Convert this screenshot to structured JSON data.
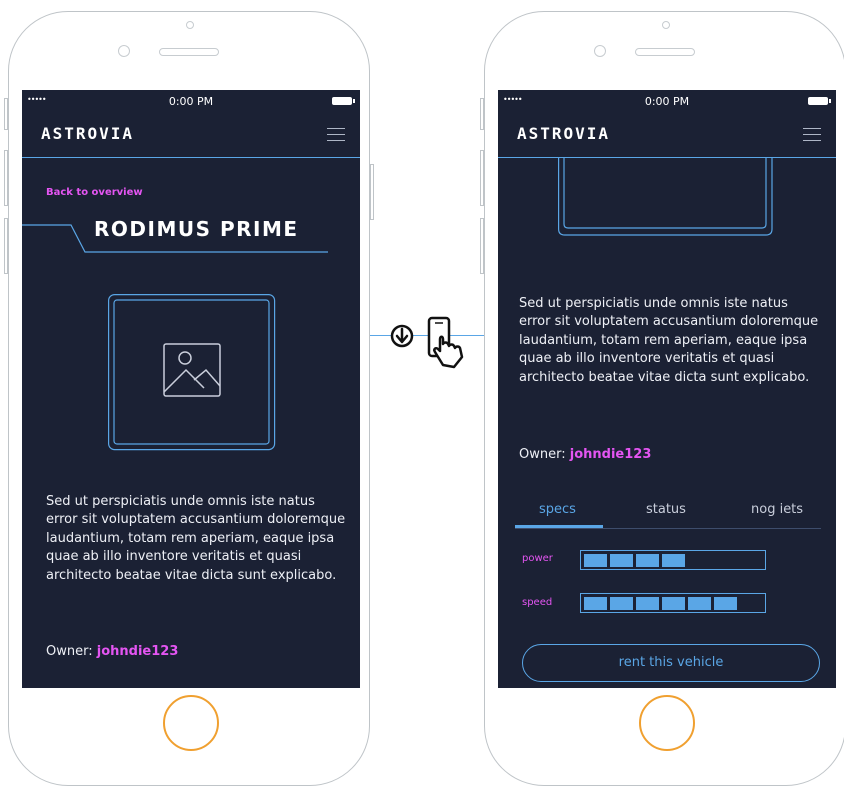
{
  "status_bar": {
    "signal": "•••••",
    "time": "0:00 PM"
  },
  "header": {
    "logo": "ASTROVIA",
    "menu_icon": "hamburger-menu-icon"
  },
  "detail": {
    "back_link": "Back to overview",
    "title": "RODIMUS PRIME",
    "image_icon": "image-placeholder-icon",
    "description": "Sed ut perspiciatis unde omnis iste natus error sit voluptatem accusantium doloremque laudantium, totam rem aperiam, eaque ipsa quae ab illo inventore veritatis et quasi architecto beatae vitae dicta sunt explicabo.",
    "owner_label": "Owner:",
    "owner_name": "johndie123"
  },
  "tabs": [
    {
      "label": "specs",
      "active": true
    },
    {
      "label": "status",
      "active": false
    },
    {
      "label": "nog iets",
      "active": false
    }
  ],
  "stats": [
    {
      "label": "power",
      "filled_segments": 4,
      "total_segments": 7
    },
    {
      "label": "speed",
      "filled_segments": 6,
      "total_segments": 7
    }
  ],
  "rent_button": "rent this vehicle",
  "gesture_icons": [
    "scroll-down-icon",
    "phone-swipe-hand-icon"
  ],
  "colors": {
    "screen_bg": "#1b2134",
    "accent_blue": "#5aa6e6",
    "accent_magenta": "#e455f2",
    "home_button": "#f0a030"
  }
}
